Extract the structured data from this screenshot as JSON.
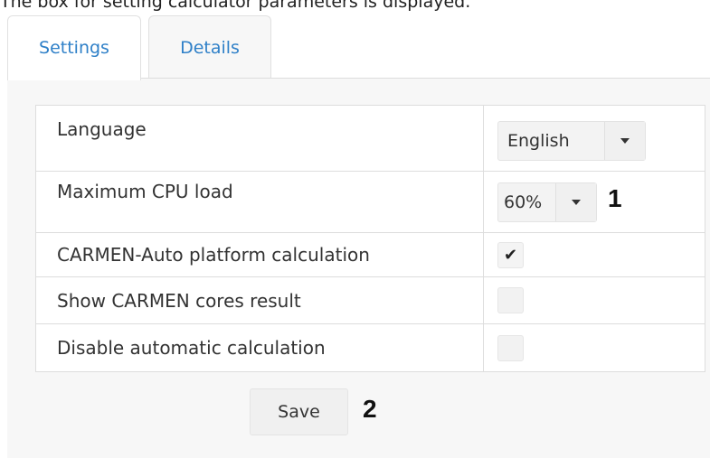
{
  "caption": "The box for setting calculator parameters is displayed.",
  "tabs": [
    {
      "label": "Settings",
      "active": true
    },
    {
      "label": "Details",
      "active": false
    }
  ],
  "settings": {
    "language": {
      "label": "Language",
      "value": "English"
    },
    "cpu_load": {
      "label": "Maximum CPU load",
      "value": "60%",
      "marker": "1"
    },
    "carmen_auto": {
      "label": "CARMEN-Auto platform calculation",
      "checked": true,
      "check_glyph": "✔"
    },
    "carmen_cores": {
      "label": "Show CARMEN cores result",
      "checked": false
    },
    "disable_auto": {
      "label": "Disable automatic calculation",
      "checked": false
    }
  },
  "save": {
    "label": "Save",
    "marker": "2"
  },
  "colors": {
    "tab_text": "#2f80c8",
    "panel_bg": "#f7f7f7",
    "border": "#dddddd"
  }
}
